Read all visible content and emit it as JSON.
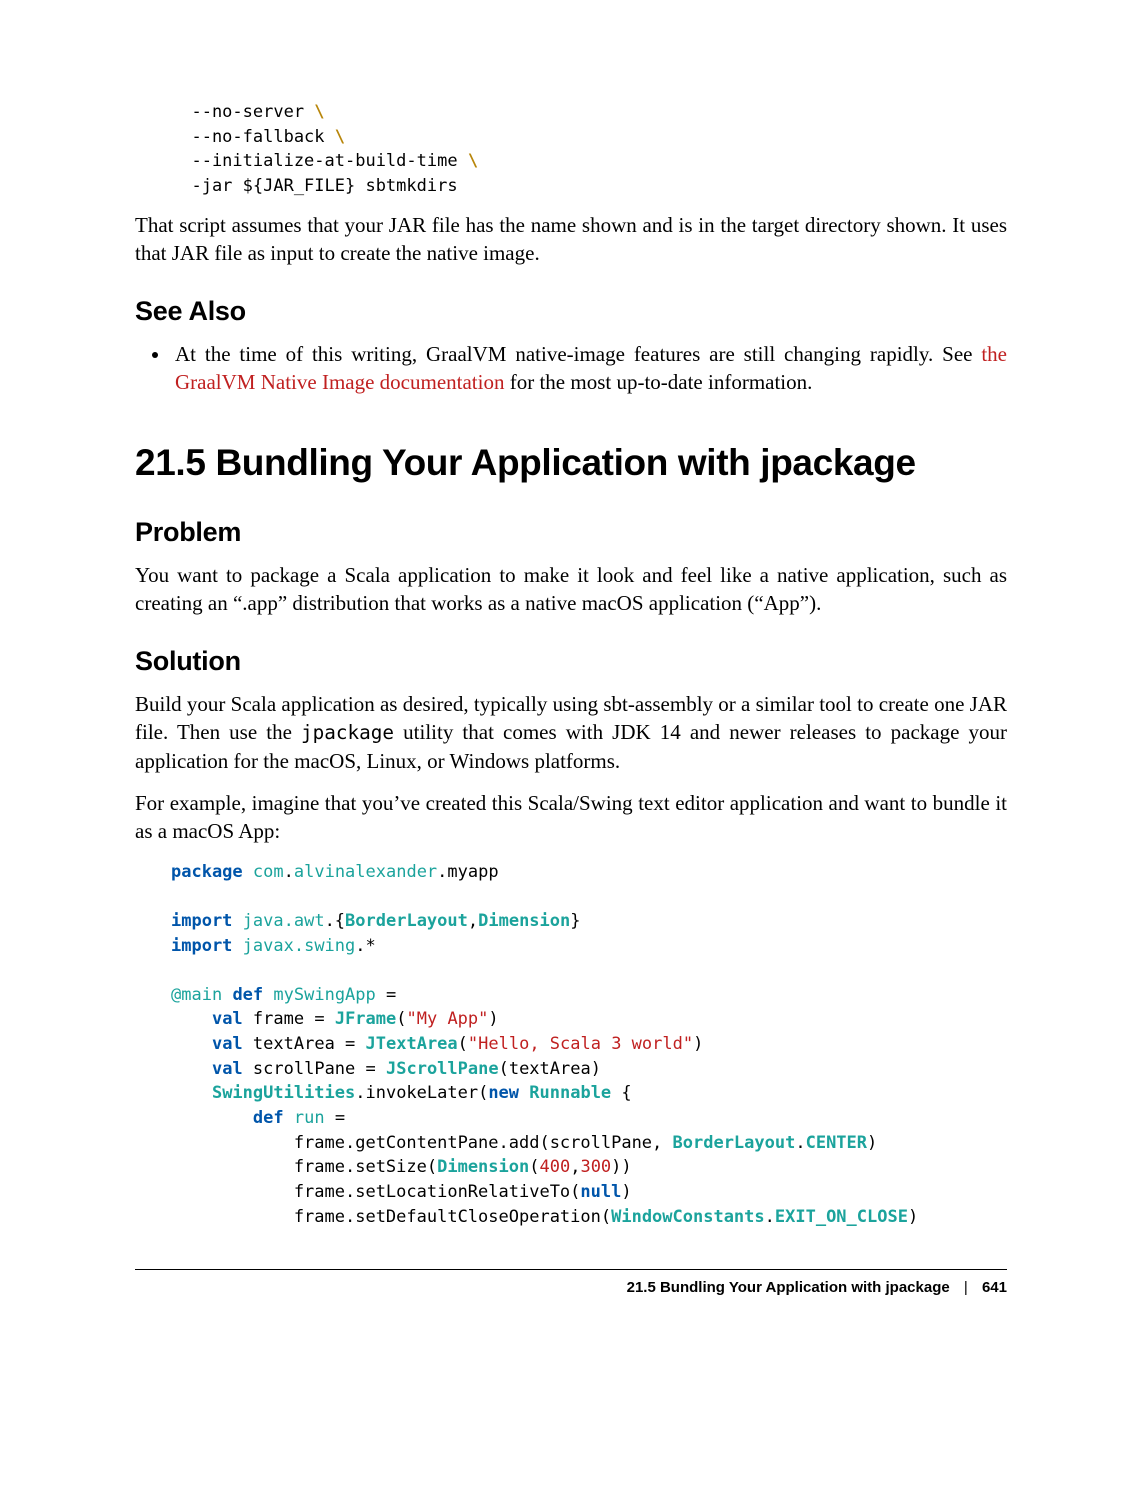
{
  "shell_code": {
    "l1a": "  --no-server ",
    "l2a": "  --no-fallback ",
    "l3a": "  --initialize-at-build-time ",
    "bs": "\\",
    "l4": "  -jar ${JAR_FILE} sbtmkdirs"
  },
  "para1": "That script assumes that your JAR file has the name shown and is in the target directory shown. It uses that JAR file as input to create the native image.",
  "see_also_heading": "See Also",
  "see_also_item": {
    "pre": "At the time of this writing, GraalVM native-image features are still changing rapidly. See ",
    "link": "the GraalVM Native Image documentation",
    "post": " for the most up-to-date information."
  },
  "recipe_heading": "21.5 Bundling Your Application with jpackage",
  "problem_heading": "Problem",
  "problem_body": "You want to package a Scala application to make it look and feel like a native application, such as creating an “.app” distribution that works as a native macOS application (“App”).",
  "solution_heading": "Solution",
  "solution_body1": {
    "pre": "Build your Scala application as desired, typically using sbt-assembly or a similar tool to create one JAR file. Then use the ",
    "code": "jpackage",
    "post": " utility that comes with JDK 14 and newer releases to package your application for the macOS, Linux, or Windows platforms."
  },
  "solution_body2": "For example, imagine that you’ve created this Scala/Swing text editor application and want to bundle it as a macOS App:",
  "scala": {
    "pkg_kw": "package",
    "pkg_ns1": "com",
    "pkg_ns2": "alvinalexander",
    "pkg_tail": ".myapp",
    "imp_kw": "import",
    "imp1_ns": "java.awt",
    "imp1_br": ".{",
    "imp1_a": "BorderLayout",
    "imp1_c": ",",
    "imp1_b": "Dimension",
    "imp1_br2": "}",
    "imp2_ns": "javax.swing",
    "imp2_tail": ".*",
    "ann": "@main",
    "def_kw": "def",
    "fn": "mySwingApp",
    "val_kw": "val",
    "new_kw": "new",
    "frame_var": "frame",
    "ta_var": "textArea",
    "sp_var": "scrollPane",
    "eq": " = ",
    "jframe": "JFrame",
    "jta": "JTextArea",
    "jsp": "JScrollPane",
    "su": "SwingUtilities",
    "runnable": "Runnable",
    "run": "run",
    "bl": "BorderLayout",
    "center": "CENTER",
    "dim": "Dimension",
    "wc": "WindowConstants",
    "exit": "EXIT_ON_CLOSE",
    "null": "null",
    "str1": "\"My App\"",
    "str2": "\"Hello, Scala 3 world\"",
    "n400": "400",
    "n300": "300",
    "line_gcp": "            frame.getContentPane.add(scrollPane, ",
    "line_size1": "            frame.setSize(",
    "line_loc1": "            frame.setLocationRelativeTo(",
    "line_close1": "            frame.setDefaultCloseOperation(",
    "dot": ".",
    "open": "(",
    "close": ")",
    "comma": ",",
    "invoke": ".invokeLater(",
    "brace_open": " {",
    "brace_close": "}"
  },
  "footer": {
    "title": "21.5 Bundling Your Application with jpackage",
    "sep": "|",
    "pageno": "641"
  }
}
